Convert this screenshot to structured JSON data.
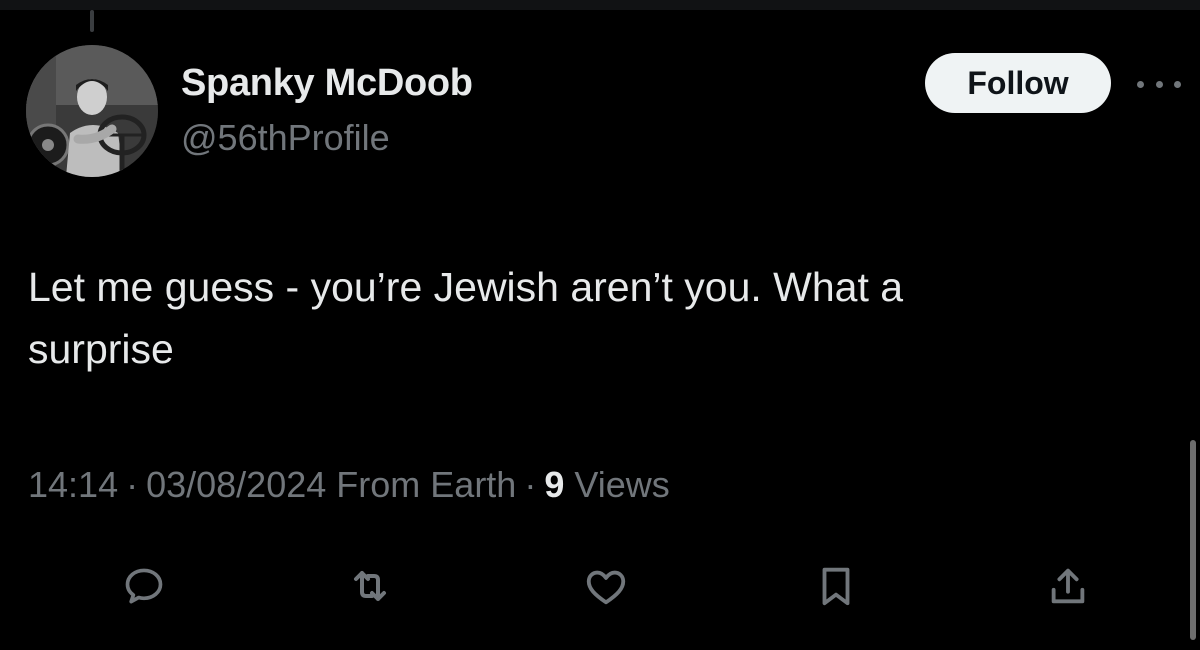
{
  "author": {
    "display_name": "Spanky McDoob",
    "handle": "@56thProfile",
    "avatar": "avatar-photo-man-at-steering-wheel"
  },
  "follow_label": "Follow",
  "tweet": {
    "text_line1": "Let me guess - you’re Jewish aren’t you. What a",
    "text_line2": "surprise"
  },
  "meta": {
    "time": "14:14",
    "separator": "·",
    "date": "03/08/2024",
    "source": "From Earth",
    "views_count": "9",
    "views_label": "Views"
  },
  "actions": [
    {
      "name": "reply-icon"
    },
    {
      "name": "retweet-icon"
    },
    {
      "name": "like-icon"
    },
    {
      "name": "bookmark-icon"
    },
    {
      "name": "share-icon"
    }
  ],
  "colors": {
    "background": "#000000",
    "primary_text": "#e7e9ea",
    "secondary_text": "#71767b",
    "follow_button_bg": "#eff3f4"
  }
}
